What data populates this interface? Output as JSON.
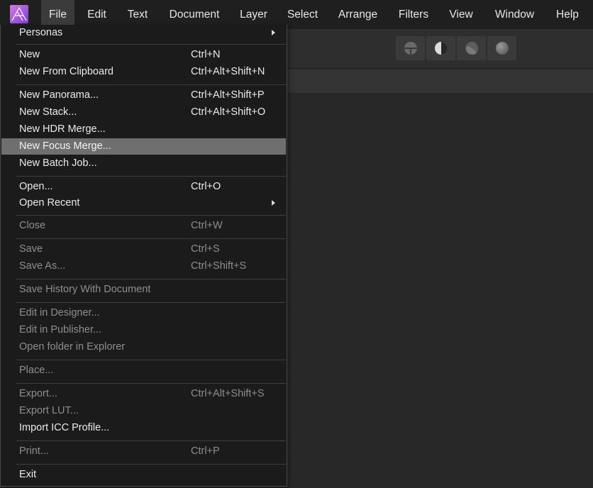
{
  "menubar": {
    "items": [
      {
        "label": "File"
      },
      {
        "label": "Edit"
      },
      {
        "label": "Text"
      },
      {
        "label": "Document"
      },
      {
        "label": "Layer"
      },
      {
        "label": "Select"
      },
      {
        "label": "Arrange"
      },
      {
        "label": "Filters"
      },
      {
        "label": "View"
      },
      {
        "label": "Window"
      },
      {
        "label": "Help"
      }
    ],
    "active": "File"
  },
  "colors": {
    "logo_gradient": [
      "#c86bd9",
      "#7a3fd0"
    ],
    "highlight": "#6f6f6f"
  },
  "persona_icons": [
    "photo-persona-icon",
    "liquify-persona-icon",
    "develop-persona-icon",
    "tone-mapping-persona-icon"
  ],
  "file_menu": {
    "items": [
      {
        "label": "Personas",
        "shortcut": "",
        "submenu": true,
        "enabled": true
      },
      {
        "label": "New",
        "shortcut": "Ctrl+N",
        "enabled": true
      },
      {
        "label": "New From Clipboard",
        "shortcut": "Ctrl+Alt+Shift+N",
        "enabled": true
      },
      {
        "label": "New Panorama...",
        "shortcut": "Ctrl+Alt+Shift+P",
        "enabled": true
      },
      {
        "label": "New Stack...",
        "shortcut": "Ctrl+Alt+Shift+O",
        "enabled": true
      },
      {
        "label": "New HDR Merge...",
        "shortcut": "",
        "enabled": true
      },
      {
        "label": "New Focus Merge...",
        "shortcut": "",
        "enabled": true,
        "highlighted": true
      },
      {
        "label": "New Batch Job...",
        "shortcut": "",
        "enabled": true
      },
      {
        "label": "Open...",
        "shortcut": "Ctrl+O",
        "enabled": true
      },
      {
        "label": "Open Recent",
        "shortcut": "",
        "submenu": true,
        "enabled": true
      },
      {
        "label": "Close",
        "shortcut": "Ctrl+W",
        "enabled": false
      },
      {
        "label": "Save",
        "shortcut": "Ctrl+S",
        "enabled": false
      },
      {
        "label": "Save As...",
        "shortcut": "Ctrl+Shift+S",
        "enabled": false
      },
      {
        "label": "Save History With Document",
        "shortcut": "",
        "enabled": false
      },
      {
        "label": "Edit in Designer...",
        "shortcut": "",
        "enabled": false
      },
      {
        "label": "Edit in Publisher...",
        "shortcut": "",
        "enabled": false
      },
      {
        "label": "Open folder in Explorer",
        "shortcut": "",
        "enabled": false
      },
      {
        "label": "Place...",
        "shortcut": "",
        "enabled": false
      },
      {
        "label": "Export...",
        "shortcut": "Ctrl+Alt+Shift+S",
        "enabled": false
      },
      {
        "label": "Export LUT...",
        "shortcut": "",
        "enabled": false
      },
      {
        "label": "Import ICC Profile...",
        "shortcut": "",
        "enabled": true
      },
      {
        "label": "Print...",
        "shortcut": "Ctrl+P",
        "enabled": false
      },
      {
        "label": "Exit",
        "shortcut": "",
        "enabled": true
      }
    ]
  }
}
